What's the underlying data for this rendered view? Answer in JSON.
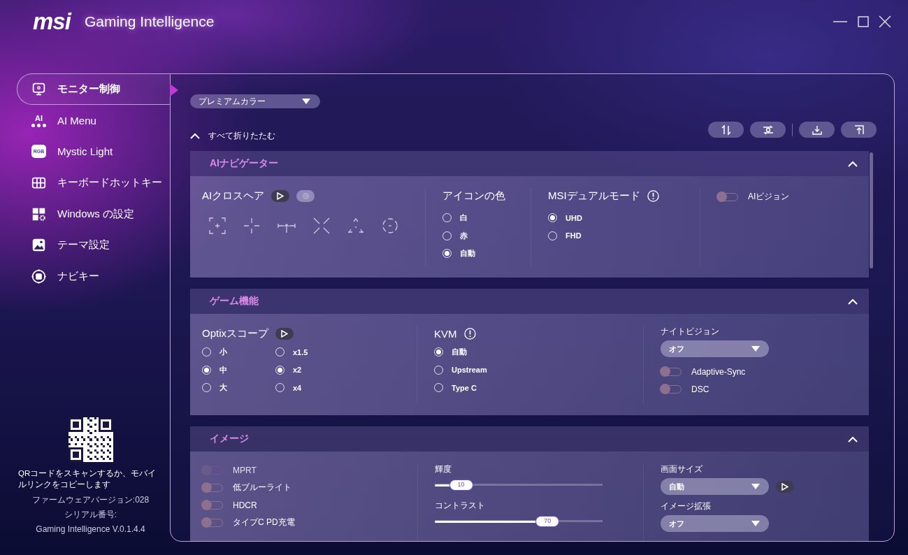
{
  "app": {
    "brand": "msi",
    "title": "Gaming Intelligence"
  },
  "sidebar": {
    "items": [
      {
        "label": "モニター制御",
        "selected": true
      },
      {
        "label": "AI Menu",
        "badge": "AI",
        "selected": false
      },
      {
        "label": "Mystic Light",
        "badge": "RGB",
        "selected": false
      },
      {
        "label": "キーボードホットキー",
        "selected": false
      },
      {
        "label": "Windows の設定",
        "selected": false
      },
      {
        "label": "テーマ設定",
        "selected": false
      },
      {
        "label": "ナビキー",
        "selected": false
      }
    ],
    "qr_caption": "QRコードをスキャンするか、モバイルリンクをコピーします",
    "firmware": "ファームウェアバージョン:028",
    "serial": "シリアル番号:",
    "version": "Gaming Intelligence V.0.1.4.4"
  },
  "profile_dropdown": {
    "value": "プレミアムカラー"
  },
  "collapse_all": "すべて折りたたむ",
  "sections": [
    {
      "title": "AIナビゲーター",
      "expanded": true,
      "groups": [
        {
          "kind": "crosshair",
          "label": "AIクロスヘア",
          "play": true,
          "settings": true
        },
        {
          "kind": "radio",
          "label": "アイコンの色",
          "columns": [
            {
              "options": [
                {
                  "label": "白",
                  "selected": false
                },
                {
                  "label": "赤",
                  "selected": false
                },
                {
                  "label": "自動",
                  "selected": true
                }
              ]
            }
          ]
        },
        {
          "kind": "radio",
          "label": "MSIデュアルモード",
          "info": true,
          "columns": [
            {
              "options": [
                {
                  "label": "UHD",
                  "selected": true
                },
                {
                  "label": "FHD",
                  "selected": false
                }
              ]
            }
          ]
        },
        {
          "kind": "items",
          "items": [
            {
              "kind": "toggle",
              "label": "AIビジョン",
              "on": false,
              "disabled": false
            }
          ]
        }
      ]
    },
    {
      "title": "ゲーム機能",
      "expanded": true,
      "groups": [
        {
          "kind": "radio",
          "label": "Optixスコープ",
          "play": true,
          "columns": [
            {
              "options": [
                {
                  "label": "小",
                  "selected": false
                },
                {
                  "label": "中",
                  "selected": true
                },
                {
                  "label": "大",
                  "selected": false
                }
              ]
            },
            {
              "options": [
                {
                  "label": "x1.5",
                  "selected": false
                },
                {
                  "label": "x2",
                  "selected": true
                },
                {
                  "label": "x4",
                  "selected": false
                }
              ]
            }
          ]
        },
        {
          "kind": "radio",
          "label": "KVM",
          "info": true,
          "columns": [
            {
              "options": [
                {
                  "label": "自動",
                  "selected": true
                },
                {
                  "label": "Upstream",
                  "selected": false
                },
                {
                  "label": "Type C",
                  "selected": false
                }
              ]
            }
          ]
        },
        {
          "kind": "items",
          "items": [
            {
              "kind": "dropdown",
              "label": "ナイトビジョン",
              "value": "オフ"
            },
            {
              "kind": "toggle",
              "label": "Adaptive-Sync",
              "on": false,
              "disabled": false
            },
            {
              "kind": "toggle",
              "label": "DSC",
              "on": false,
              "disabled": false
            }
          ]
        }
      ]
    },
    {
      "title": "イメージ",
      "expanded": true,
      "groups": [
        {
          "kind": "items",
          "items": [
            {
              "kind": "toggle",
              "label": "MPRT",
              "on": false,
              "disabled": true
            },
            {
              "kind": "toggle",
              "label": "低ブルーライト",
              "on": false,
              "disabled": false
            },
            {
              "kind": "toggle",
              "label": "HDCR",
              "on": false,
              "disabled": false
            },
            {
              "kind": "toggle",
              "label": "タイプC PD充電",
              "on": false,
              "disabled": false
            }
          ]
        },
        {
          "kind": "items",
          "items": [
            {
              "kind": "slider",
              "label": "輝度",
              "level": 0.1,
              "reading": "10"
            },
            {
              "kind": "slider",
              "label": "コントラスト",
              "level": 0.7,
              "reading": "70"
            }
          ]
        },
        {
          "kind": "items",
          "items": [
            {
              "kind": "dropdown",
              "label": "画面サイズ",
              "value": "自動",
              "play": true
            },
            {
              "kind": "dropdown",
              "label": "イメージ拡張",
              "value": "オフ"
            }
          ]
        }
      ]
    }
  ]
}
